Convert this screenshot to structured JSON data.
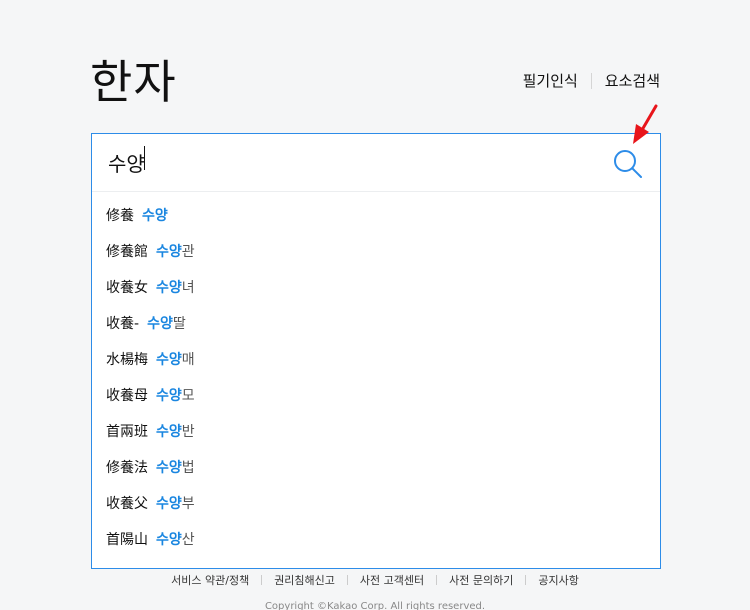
{
  "header": {
    "logo": "한자",
    "links": [
      "필기인식",
      "요소검색"
    ]
  },
  "search": {
    "value": "수양",
    "query": "수양"
  },
  "suggestions": [
    {
      "hanja": "修養",
      "highlight": "수양",
      "rest": ""
    },
    {
      "hanja": "修養館",
      "highlight": "수양",
      "rest": "관"
    },
    {
      "hanja": "收養女",
      "highlight": "수양",
      "rest": "녀"
    },
    {
      "hanja": "收養-",
      "highlight": "수양",
      "rest": "딸"
    },
    {
      "hanja": "水楊梅",
      "highlight": "수양",
      "rest": "매"
    },
    {
      "hanja": "收養母",
      "highlight": "수양",
      "rest": "모"
    },
    {
      "hanja": "首兩班",
      "highlight": "수양",
      "rest": "반"
    },
    {
      "hanja": "修養法",
      "highlight": "수양",
      "rest": "법"
    },
    {
      "hanja": "收養父",
      "highlight": "수양",
      "rest": "부"
    },
    {
      "hanja": "首陽山",
      "highlight": "수양",
      "rest": "산"
    }
  ],
  "footer": {
    "links": [
      "서비스 약관/정책",
      "권리침해신고",
      "사전 고객센터",
      "사전 문의하기",
      "공지사항"
    ],
    "copyright": "Copyright ©Kakao Corp. All rights reserved."
  },
  "colors": {
    "accent": "#2d8ce8",
    "highlight": "#1a86e0",
    "annotation_arrow": "#e8151b"
  },
  "icons": {
    "search": "search-icon",
    "annotation": "red-arrow-icon"
  }
}
